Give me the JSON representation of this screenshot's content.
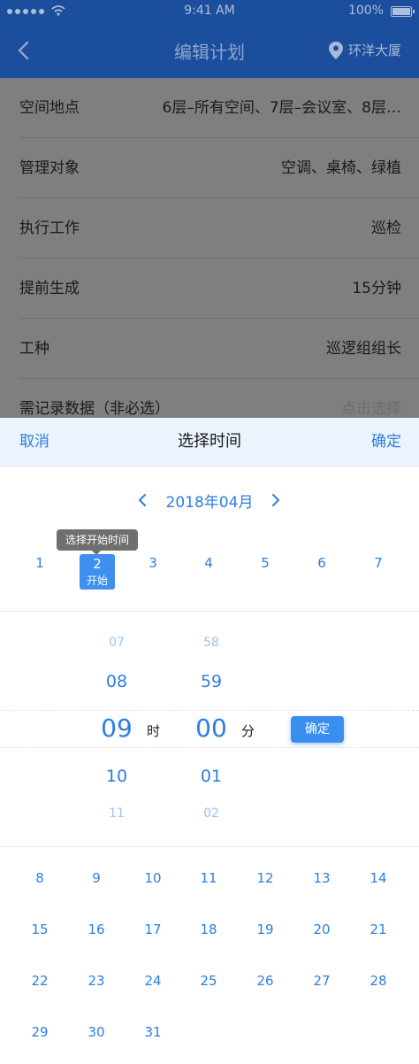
{
  "status_bar": {
    "time": "9:41 AM",
    "battery": "100%"
  },
  "nav": {
    "title": "编辑计划",
    "location": "环洋大厦"
  },
  "form": {
    "rows": [
      {
        "label": "空间地点",
        "value": "6层–所有空间、7层–会议室、8层…"
      },
      {
        "label": "管理对象",
        "value": "空调、桌椅、绿植"
      },
      {
        "label": "执行工作",
        "value": "巡检"
      },
      {
        "label": "提前生成",
        "value": "15分钟"
      },
      {
        "label": "工种",
        "value": "巡逻组组长"
      },
      {
        "label": "需记录数据（非必选）",
        "value": "点击选择"
      }
    ]
  },
  "sheet": {
    "cancel": "取消",
    "title": "选择时间",
    "confirm": "确定",
    "month": "2018年04月",
    "tooltip": "选择开始时间",
    "selected_day": {
      "day": "2",
      "tag": "开始"
    },
    "week_one": [
      "1",
      "2",
      "3",
      "4",
      "5",
      "6",
      "7"
    ],
    "hours": [
      "07",
      "08",
      "09",
      "10",
      "11"
    ],
    "minutes": [
      "58",
      "59",
      "00",
      "01",
      "02"
    ],
    "hour_unit": "时",
    "minute_unit": "分",
    "time_confirm": "确定",
    "days_rest": [
      [
        "8",
        "9",
        "10",
        "11",
        "12",
        "13",
        "14"
      ],
      [
        "15",
        "16",
        "17",
        "18",
        "19",
        "20",
        "21"
      ],
      [
        "22",
        "23",
        "24",
        "25",
        "26",
        "27",
        "28"
      ],
      [
        "29",
        "30",
        "31"
      ]
    ]
  },
  "colors": {
    "nav_bg": "#1c4e9e",
    "accent": "#2d7ee0",
    "selected_bg": "#3f8fee",
    "overlay": "#7f7f7f"
  }
}
